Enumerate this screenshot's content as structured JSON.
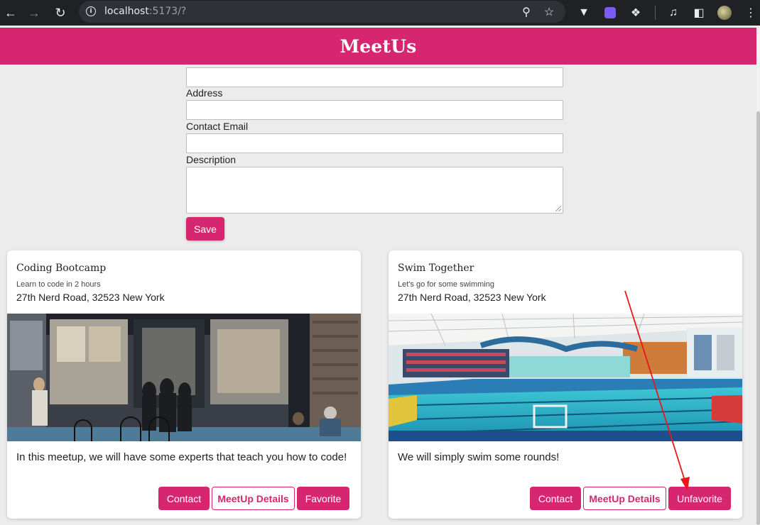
{
  "browser": {
    "url_host": "localhost",
    "url_rest": ":5173/?"
  },
  "app": {
    "title": "MeetUs"
  },
  "form": {
    "address_label": "Address",
    "email_label": "Contact Email",
    "description_label": "Description",
    "save_label": "Save"
  },
  "cards": [
    {
      "title": "Coding Bootcamp",
      "subtitle": "Learn to code in 2 hours",
      "address": "27th Nerd Road, 32523 New York",
      "description": "In this meetup, we will have some experts that teach you how to code!",
      "contact_label": "Contact",
      "details_label": "MeetUp Details",
      "favorite_label": "Favorite"
    },
    {
      "title": "Swim Together",
      "subtitle": "Let's go for some swimming",
      "address": "27th Nerd Road, 32523 New York",
      "description": "We will simply swim some rounds!",
      "contact_label": "Contact",
      "details_label": "MeetUp Details",
      "favorite_label": "Unfavorite"
    }
  ],
  "colors": {
    "brand": "#d6266f",
    "annotation": "#e8171a"
  }
}
